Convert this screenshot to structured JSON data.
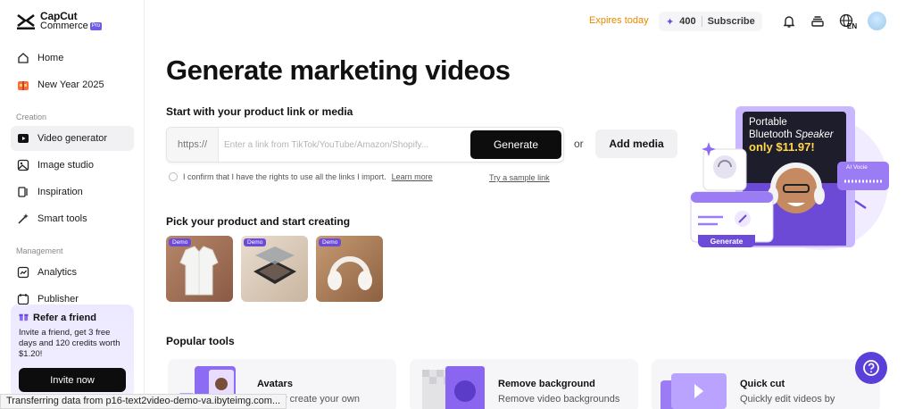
{
  "brand": {
    "line1": "CapCut",
    "line2": "Commerce",
    "badge": "Pro"
  },
  "sidebar": {
    "items": [
      {
        "label": "Home",
        "icon": "home-icon"
      },
      {
        "label": "New Year 2025",
        "icon": "gift-icon"
      },
      {
        "label": "Video generator",
        "icon": "video-icon",
        "active": true
      },
      {
        "label": "Image studio",
        "icon": "image-icon"
      },
      {
        "label": "Inspiration",
        "icon": "inspiration-icon"
      },
      {
        "label": "Smart tools",
        "icon": "magic-wand-icon"
      },
      {
        "label": "Analytics",
        "icon": "analytics-icon"
      },
      {
        "label": "Publisher",
        "icon": "calendar-icon"
      }
    ],
    "sections": {
      "creation": "Creation",
      "management": "Management"
    },
    "refer": {
      "title": "Refer a friend",
      "description": "Invite a friend, get 3 free days and 120 credits worth $1.20!",
      "button": "Invite now"
    }
  },
  "header": {
    "expires": "Expires today",
    "credits": "400",
    "subscribe": "Subscribe",
    "language": "EN"
  },
  "main": {
    "title": "Generate marketing videos",
    "start_label": "Start with your product link or media",
    "link_prefix": "https://",
    "link_placeholder": "Enter a link from TikTok/YouTube/Amazon/Shopify...",
    "generate": "Generate",
    "or": "or",
    "add_media": "Add media",
    "confirm_text": "I confirm that I have the rights to use all the links I import.",
    "learn_more": "Learn more",
    "sample_link": "Try a sample link",
    "pick_title": "Pick your product and start creating",
    "products": [
      {
        "badge": "Demo",
        "name": "white-shirt"
      },
      {
        "badge": "Demo",
        "name": "eyeshadow-palette"
      },
      {
        "badge": "Demo",
        "name": "headphones"
      }
    ],
    "popular_title": "Popular tools",
    "tools": [
      {
        "name": "Avatars",
        "desc": "Pick or create your own"
      },
      {
        "name": "Remove background",
        "desc": "Remove video backgrounds"
      },
      {
        "name": "Quick cut",
        "desc": "Quickly edit videos by"
      }
    ]
  },
  "hero": {
    "line1": "Portable",
    "line2_a": "Bluetooth ",
    "line2_b": "Speaker",
    "price": "only $11.97!",
    "ai_voice": "AI Vocie",
    "generate": "Generate"
  },
  "status_bar": "Transferring data from p16-text2video-demo-va.ibyteimg.com...",
  "colors": {
    "accent": "#6c4bd8",
    "expires": "#e58a00",
    "primary_button": "#0d0d0d"
  }
}
